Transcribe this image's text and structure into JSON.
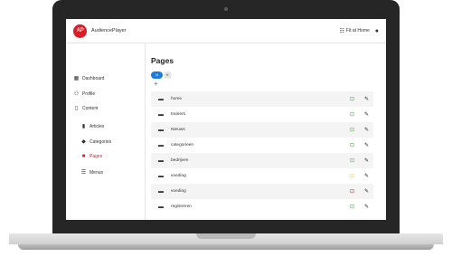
{
  "app": {
    "logo_text": "AP",
    "name": "AudiencePlayer"
  },
  "header": {
    "lang_label": "Fit at Home",
    "lang_icon": "translate-icon",
    "user_icon": "user-icon"
  },
  "sidebar": {
    "items": [
      {
        "label": "Dashboard",
        "icon": "dashboard-icon"
      },
      {
        "label": "Profile",
        "icon": "user-icon"
      },
      {
        "label": "Content",
        "icon": "content-icon"
      },
      {
        "label": "Articles",
        "icon": "bookmark-icon"
      },
      {
        "label": "Categories",
        "icon": "tag-icon"
      },
      {
        "label": "Pages",
        "icon": "page-icon",
        "active": true
      },
      {
        "label": "Menus",
        "icon": "menu-icon"
      }
    ]
  },
  "main": {
    "title": "Pages",
    "languages": [
      {
        "label": "nl",
        "active": true
      },
      {
        "label": "fr",
        "active": false
      }
    ],
    "add_symbol": "+",
    "pages": [
      {
        "name": "home",
        "status": "unlocked"
      },
      {
        "name": "trainers",
        "status": "unlocked"
      },
      {
        "name": "Nieuws",
        "status": "unlocked"
      },
      {
        "name": "categorieen",
        "status": "unlocked"
      },
      {
        "name": "bedrijven",
        "status": "unlocked"
      },
      {
        "name": "voeding",
        "status": "pending"
      },
      {
        "name": "voeding",
        "status": "locked"
      },
      {
        "name": "registreren",
        "status": "unlocked"
      }
    ]
  },
  "colors": {
    "brand": "#d91f26",
    "active_pill": "#1c7ce0",
    "unlocked": "#3cb043",
    "pending": "#f2c94c",
    "locked": "#d91f26"
  }
}
